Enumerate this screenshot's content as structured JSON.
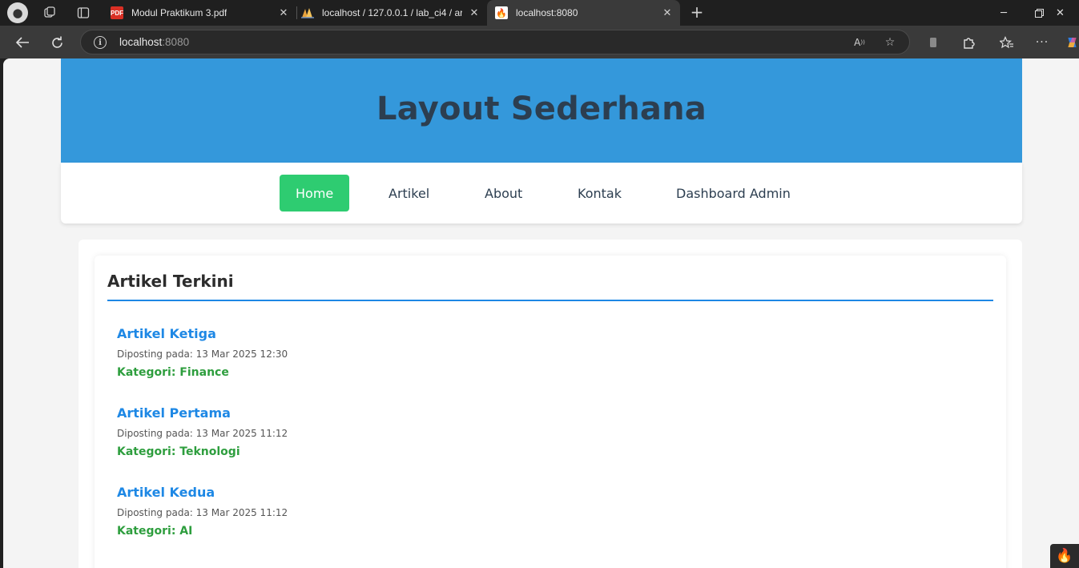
{
  "browser": {
    "tabs": [
      {
        "title": "Modul Praktikum 3.pdf",
        "favicon": "pdf-icon",
        "active": false
      },
      {
        "title": "localhost / 127.0.0.1 / lab_ci4 / ar",
        "favicon": "phpmyadmin-icon",
        "active": false
      },
      {
        "title": "localhost:8080",
        "favicon": "codeigniter-icon",
        "active": true
      }
    ],
    "address": {
      "host": "localhost",
      "port": ":8080"
    },
    "colors": {
      "frame": "#1f1f1f",
      "toolbar": "#3a3a3a"
    }
  },
  "page": {
    "header_title": "Layout Sederhana",
    "nav": [
      {
        "label": "Home",
        "active": true
      },
      {
        "label": "Artikel",
        "active": false
      },
      {
        "label": "About",
        "active": false
      },
      {
        "label": "Kontak",
        "active": false
      },
      {
        "label": "Dashboard Admin",
        "active": false
      }
    ],
    "section_title": "Artikel Terkini",
    "articles": [
      {
        "title": "Artikel Ketiga",
        "date": "Diposting pada: 13 Mar 2025 12:30",
        "category": "Kategori: Finance"
      },
      {
        "title": "Artikel Pertama",
        "date": "Diposting pada: 13 Mar 2025 11:12",
        "category": "Kategori: Teknologi"
      },
      {
        "title": "Artikel Kedua",
        "date": "Diposting pada: 13 Mar 2025 11:12",
        "category": "Kategori: AI"
      }
    ],
    "colors": {
      "header": "#3498db",
      "header_text": "#2c3e50",
      "nav_active": "#2ecc71",
      "link": "#1e88e5",
      "category": "#2e9e3e"
    }
  }
}
